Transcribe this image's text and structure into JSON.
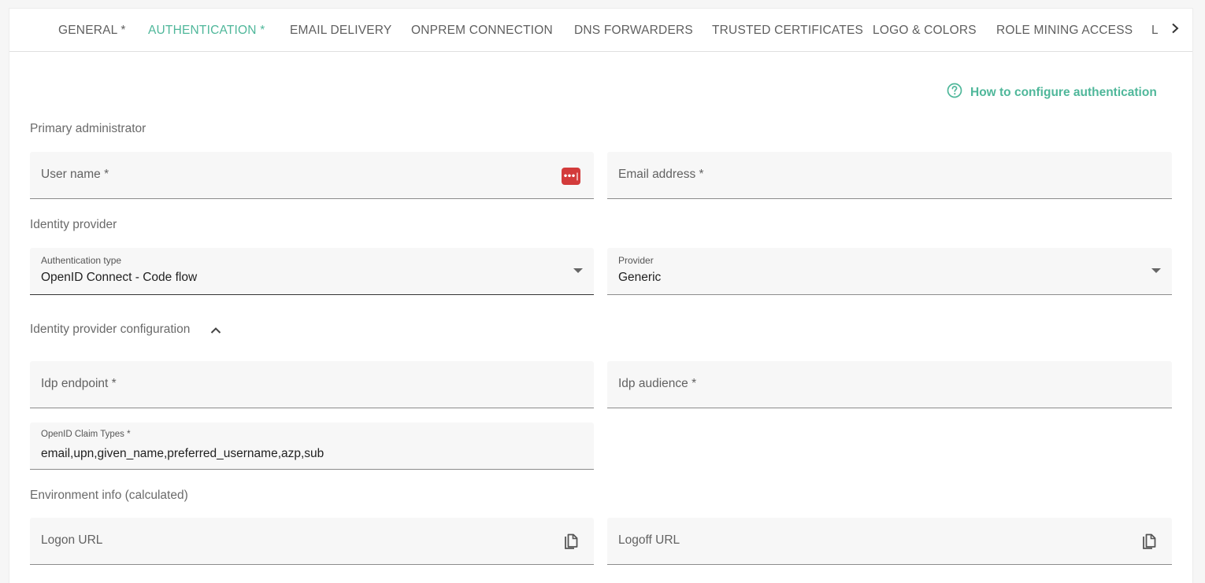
{
  "tabs": [
    {
      "label": "GENERAL *",
      "active": false
    },
    {
      "label": "AUTHENTICATION *",
      "active": true
    },
    {
      "label": "EMAIL DELIVERY",
      "active": false
    },
    {
      "label": "ONPREM CONNECTION",
      "active": false
    },
    {
      "label": "DNS FORWARDERS",
      "active": false
    },
    {
      "label": "TRUSTED CERTIFICATES",
      "active": false
    },
    {
      "label": "LOGO & COLORS",
      "active": false
    },
    {
      "label": "ROLE MINING ACCESS",
      "active": false
    },
    {
      "label": "L",
      "active": false
    }
  ],
  "accent_color": "#4fb79a",
  "help_link": {
    "label": "How to configure authentication",
    "icon": "help-circle-icon"
  },
  "sections": {
    "primary_admin": "Primary administrator",
    "identity_provider": "Identity provider",
    "idp_config": "Identity provider configuration",
    "env_info": "Environment info (calculated)"
  },
  "fields": {
    "user_name": {
      "placeholder": "User name *",
      "icon": "password-manager-icon"
    },
    "email": {
      "placeholder": "Email address *"
    },
    "auth_type": {
      "label": "Authentication type",
      "value": "OpenID Connect - Code flow"
    },
    "provider": {
      "label": "Provider",
      "value": "Generic"
    },
    "idp_endpoint": {
      "placeholder": "Idp endpoint *"
    },
    "idp_audience": {
      "placeholder": "Idp audience *"
    },
    "claim_types": {
      "label": "OpenID Claim Types *",
      "value": "email,upn,given_name,preferred_username,azp,sub"
    },
    "logon_url": {
      "placeholder": "Logon URL",
      "icon": "copy-icon"
    },
    "logoff_url": {
      "placeholder": "Logoff URL",
      "icon": "copy-icon"
    }
  },
  "pm_badge_text": "•••|"
}
